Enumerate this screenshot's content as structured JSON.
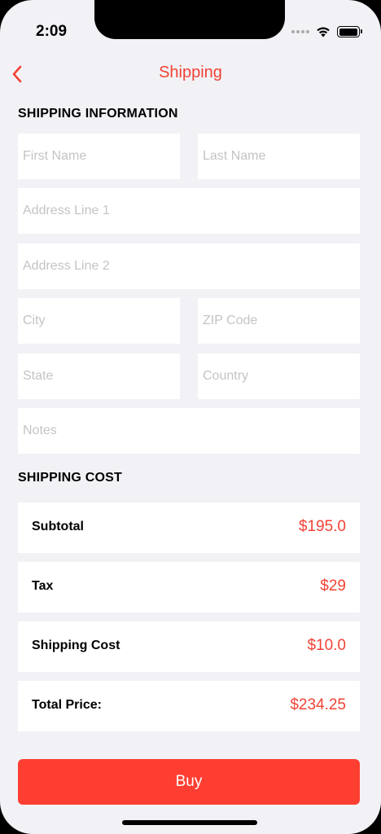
{
  "status_bar": {
    "time": "2:09"
  },
  "nav": {
    "title": "Shipping"
  },
  "shipping_info": {
    "header": "SHIPPING INFORMATION",
    "first_name_placeholder": "First Name",
    "last_name_placeholder": "Last Name",
    "address1_placeholder": "Address Line 1",
    "address2_placeholder": "Address Line 2",
    "city_placeholder": "City",
    "zip_placeholder": "ZIP Code",
    "state_placeholder": "State",
    "country_placeholder": "Country",
    "notes_placeholder": "Notes"
  },
  "shipping_cost": {
    "header": "SHIPPING COST",
    "rows": [
      {
        "label": "Subtotal",
        "value": "$195.0"
      },
      {
        "label": "Tax",
        "value": "$29"
      },
      {
        "label": "Shipping Cost",
        "value": "$10.0"
      },
      {
        "label": "Total Price:",
        "value": "$234.25"
      }
    ]
  },
  "actions": {
    "buy_label": "Buy"
  },
  "colors": {
    "accent": "#f24236",
    "button": "#fe3e31",
    "background": "#f2f2f6"
  },
  "icons": {
    "back": "chevron-left-icon",
    "wifi": "wifi-icon",
    "battery": "battery-icon",
    "signal": "signal-icon"
  }
}
